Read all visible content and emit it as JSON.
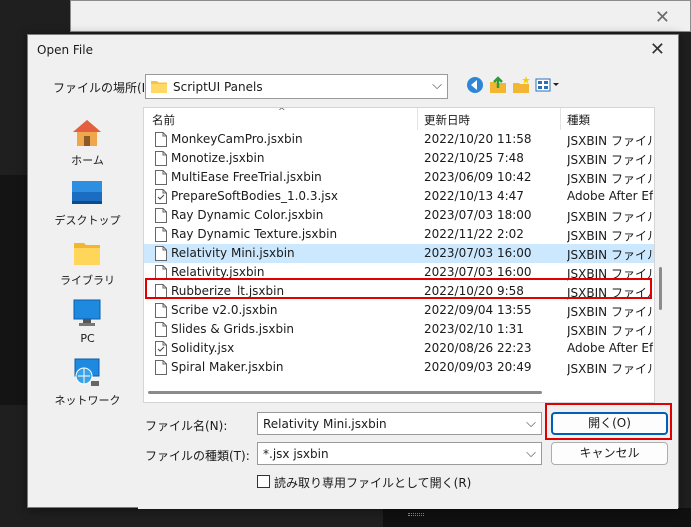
{
  "dialog": {
    "title": "Open File",
    "look_in_label": "ファイルの場所(I):",
    "look_in_value": "ScriptUI Panels"
  },
  "places": [
    {
      "label": "ホーム",
      "icon": "home-icon"
    },
    {
      "label": "デスクトップ",
      "icon": "desktop-icon"
    },
    {
      "label": "ライブラリ",
      "icon": "libraries-icon"
    },
    {
      "label": "PC",
      "icon": "pc-icon"
    },
    {
      "label": "ネットワーク",
      "icon": "network-icon"
    }
  ],
  "columns": {
    "name": "名前",
    "date": "更新日時",
    "type": "種類"
  },
  "files": [
    {
      "name": "MonkeyCamPro.jsxbin",
      "date": "2022/10/20 11:58",
      "type": "JSXBIN ファイル"
    },
    {
      "name": "Monotize.jsxbin",
      "date": "2022/10/25 7:48",
      "type": "JSXBIN ファイル"
    },
    {
      "name": "MultiEase FreeTrial.jsxbin",
      "date": "2023/06/09 10:42",
      "type": "JSXBIN ファイル"
    },
    {
      "name": "PrepareSoftBodies_1.0.3.jsx",
      "date": "2022/10/13 4:47",
      "type": "Adobe After Effe"
    },
    {
      "name": "Ray Dynamic Color.jsxbin",
      "date": "2023/07/03 18:00",
      "type": "JSXBIN ファイル"
    },
    {
      "name": "Ray Dynamic Texture.jsxbin",
      "date": "2022/11/22 2:02",
      "type": "JSXBIN ファイル"
    },
    {
      "name": "Relativity Mini.jsxbin",
      "date": "2023/07/03 16:00",
      "type": "JSXBIN ファイル"
    },
    {
      "name": "Relativity.jsxbin",
      "date": "2023/07/03 16:00",
      "type": "JSXBIN ファイル"
    },
    {
      "name": "Rubberize_lt.jsxbin",
      "date": "2022/10/20 9:58",
      "type": "JSXBIN ファイル"
    },
    {
      "name": "Scribe v2.0.jsxbin",
      "date": "2022/09/04 13:55",
      "type": "JSXBIN ファイル"
    },
    {
      "name": "Slides & Grids.jsxbin",
      "date": "2023/02/10 1:31",
      "type": "JSXBIN ファイル"
    },
    {
      "name": "Solidity.jsx",
      "date": "2020/08/26 22:23",
      "type": "Adobe After Effe"
    },
    {
      "name": "Spiral Maker.jsxbin",
      "date": "2020/09/03 20:49",
      "type": "JSXBIN ファイル"
    }
  ],
  "bottom": {
    "filename_label": "ファイル名(N):",
    "filename_value": "Relativity Mini.jsxbin",
    "filetype_label": "ファイルの種類(T):",
    "filetype_value": "*.jsx jsxbin",
    "readonly_label": "読み取り専用ファイルとして開く(R)",
    "open_label": "開く(O)",
    "cancel_label": "キャンセル"
  },
  "colors": {
    "selection": "#cce8ff",
    "highlight_outline": "#e00000",
    "default_button": "#005fb8"
  }
}
